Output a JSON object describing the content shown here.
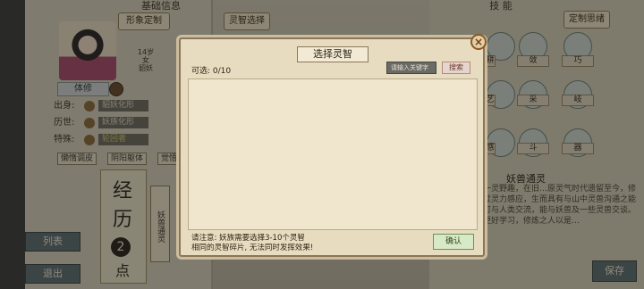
{
  "left": {
    "header": "基础信息",
    "buttons": [
      "形象定制",
      "灵智选择"
    ],
    "age": "14岁",
    "gender": "女",
    "race": "貂妖",
    "role": "体修",
    "attrs": [
      {
        "label": "出身:",
        "value": "貂妖化形"
      },
      {
        "label": "历世:",
        "value": "妖族化形"
      },
      {
        "label": "特殊:",
        "value": "轮回者"
      }
    ],
    "traits": [
      "懒惰调皮",
      "阴阳躯体",
      "觉悟"
    ],
    "experience": {
      "chars": [
        "经",
        "历"
      ],
      "points": "2",
      "unit": "点"
    },
    "tab": "妖兽通灵"
  },
  "side_buttons": [
    "列表",
    "退出"
  ],
  "right": {
    "header": "技  能",
    "custom_btn": "定制思绪",
    "skills": [
      "耕",
      "敛",
      "巧",
      "艺",
      "采",
      "岐",
      "感",
      "斗",
      "器"
    ],
    "desc_title": "妖兽通灵",
    "desc": "一门山中一灵野趣，在旧…原灵气时代遗留至今，修炼者可通过灵力感应，生而具有与山中灵兽沟通之能力…。也可与人类交流，能与妖兽及一些灵兽交谈。这门法术更好学习，修炼之人以是…"
  },
  "save_label": "保存",
  "modal": {
    "title": "选择灵智",
    "count_label": "可选: 0/10",
    "search_placeholder": "请输入关键字",
    "search_label": "搜索",
    "notice_line1": "请注意: 妖族需要选择3-10个灵智",
    "notice_line2": "相同的灵智碎片, 无法同时发挥效果!",
    "confirm_label": "确认",
    "close_label": "×"
  }
}
